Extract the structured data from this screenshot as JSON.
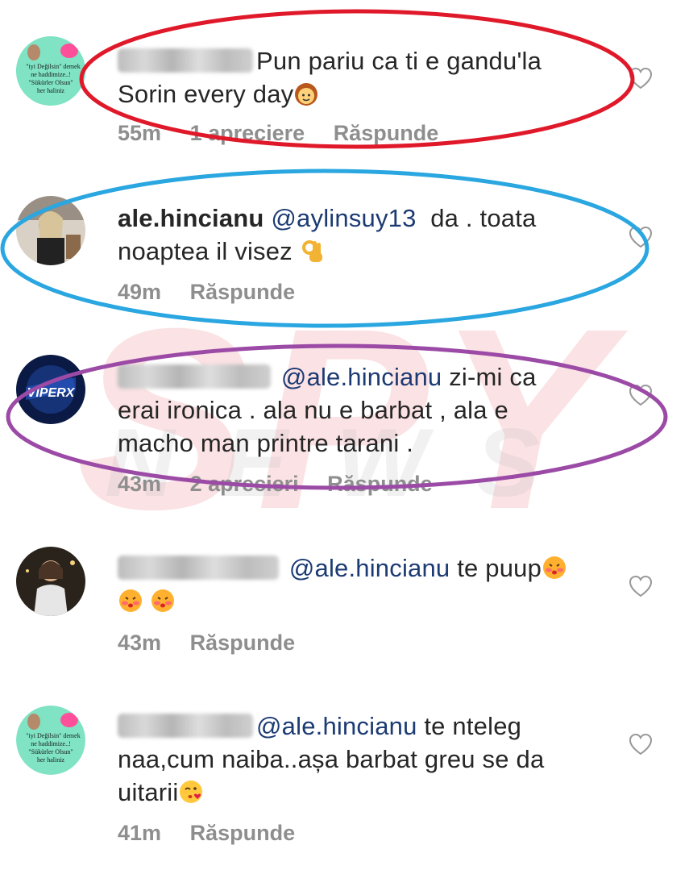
{
  "watermark": {
    "line1": "SPY",
    "line2": "NEWS"
  },
  "avatar_texts": {
    "first": [
      "\"iyi Değilsin\" demek",
      "ne haddimize..!",
      "\"Sükürler Olsun\"",
      "her haliniz"
    ],
    "third": "VIPERX"
  },
  "comments": [
    {
      "username": "",
      "username_blurred": true,
      "mention": "",
      "text": "Pun pariu ca ti e gandu'la Sorin every day",
      "emoji": "woman-face",
      "time": "55m",
      "likes": "1 apreciere",
      "reply": "Răspunde",
      "annotation_color": "#e0192a"
    },
    {
      "username": "ale.hincianu",
      "username_blurred": false,
      "mention": "@aylinsuy13",
      "text": "da . toata noaptea il visez",
      "emoji": "ok-hand",
      "time": "49m",
      "likes": "",
      "reply": "Răspunde",
      "annotation_color": "#2aa6e0"
    },
    {
      "username": "",
      "username_blurred": true,
      "mention": "@ale.hincianu",
      "text": "zi-mi ca erai ironica . ala nu e barbat , ala e macho man printre tarani .",
      "emoji": "",
      "time": "43m",
      "likes": "2 aprecieri",
      "reply": "Răspunde",
      "annotation_color": "#9b4aa6"
    },
    {
      "username": "",
      "username_blurred": true,
      "mention": "@ale.hincianu",
      "text": "te puup",
      "emoji": "kissing-face",
      "time": "43m",
      "likes": "",
      "reply": "Răspunde",
      "annotation_color": ""
    },
    {
      "username": "",
      "username_blurred": true,
      "mention": "@ale.hincianu",
      "text": "te nteleg naa,cum naiba..așa barbat greu se da uitarii",
      "emoji": "kissing-heart-face",
      "time": "41m",
      "likes": "",
      "reply": "Răspunde",
      "annotation_color": ""
    }
  ],
  "lines": {
    "c1": [
      "Pun pariu ca ti e gandu'la",
      "Sorin every day"
    ],
    "c2": [
      "da . toata",
      "noaptea il visez"
    ],
    "c3": [
      "zi-mi ca",
      "erai ironica . ala nu e barbat , ala e",
      "macho man printre tarani ."
    ],
    "c4": [
      "te puup"
    ],
    "c5": [
      "te nteleg",
      "naa,cum naiba..așa barbat greu se da",
      "uitarii"
    ]
  }
}
